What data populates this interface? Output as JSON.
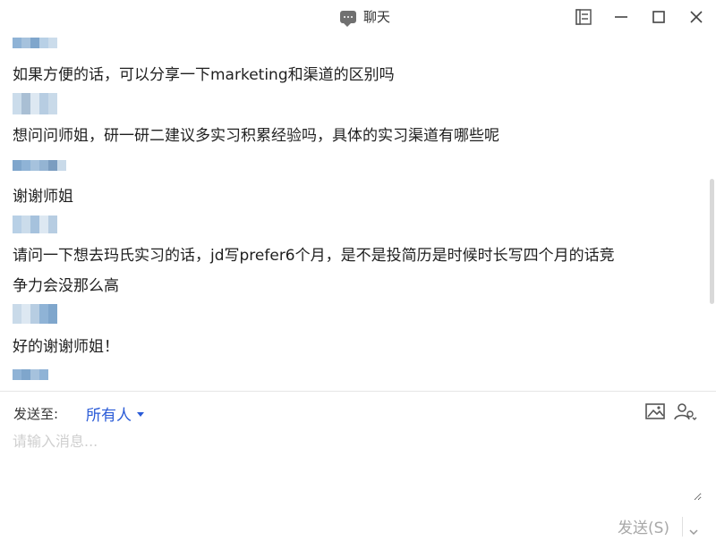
{
  "window": {
    "title": "聊天",
    "icons": [
      "chat-bubble-icon",
      "pin-window-icon",
      "minimize-icon",
      "maximize-icon",
      "close-icon"
    ]
  },
  "messages": [
    {
      "text": "如果方便的话，可以分享一下marketing和渠道的区别吗"
    },
    {
      "text": "想问问师姐，研一研二建议多实习积累经验吗，具体的实习渠道有哪些呢"
    },
    {
      "text": "谢谢师姐"
    },
    {
      "text": "请问一下想去玛氏实习的话，jd写prefer6个月，是不是投简历是时候时长写四个月的话竞\n争力会没那么高"
    },
    {
      "text": "好的谢谢师姐！"
    }
  ],
  "composer": {
    "send_to_label": "发送至:",
    "recipient": "所有人",
    "placeholder": "请输入消息...",
    "send_label": "发送(S)",
    "icons": [
      "image-icon",
      "mention-user-icon",
      "chevron-down-icon"
    ]
  },
  "colors": {
    "accent": "#2a5bd7",
    "blurred_avatar_a": "#8fb3d6",
    "blurred_avatar_b": "#cbdceb"
  }
}
